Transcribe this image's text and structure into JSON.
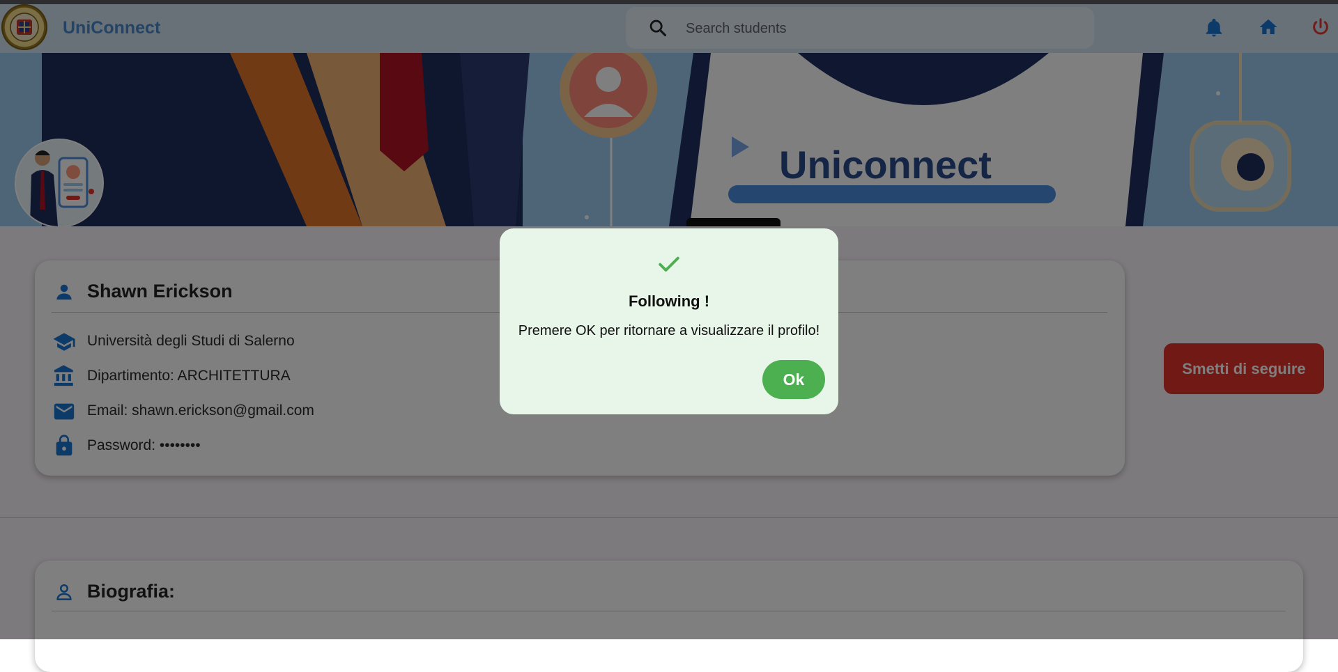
{
  "app": {
    "name": "UniConnect"
  },
  "search": {
    "placeholder": "Search students"
  },
  "banner": {
    "text": "Uniconnect"
  },
  "profile": {
    "name": "Shawn Erickson",
    "university": "Università degli Studi di Salerno",
    "department": "Dipartimento: ARCHITETTURA",
    "email": "Email: shawn.erickson@gmail.com",
    "password": "Password: ••••••••"
  },
  "actions": {
    "unfollow_label": "Smetti di seguire"
  },
  "bio": {
    "title": "Biografia:"
  },
  "dialog": {
    "title": "Following !",
    "message": "Premere OK per ritornare a visualizzare il profilo!",
    "ok_label": "Ok"
  },
  "colors": {
    "brand": "#4a86c8",
    "icon": "#1976d2",
    "unfollow": "#e3332b",
    "success": "#4caf50",
    "logout": "#e53935"
  },
  "icons": [
    "search-icon",
    "bell-icon",
    "home-icon",
    "power-icon",
    "person-icon",
    "school-icon",
    "bank-icon",
    "mail-icon",
    "lock-icon",
    "check-icon"
  ]
}
